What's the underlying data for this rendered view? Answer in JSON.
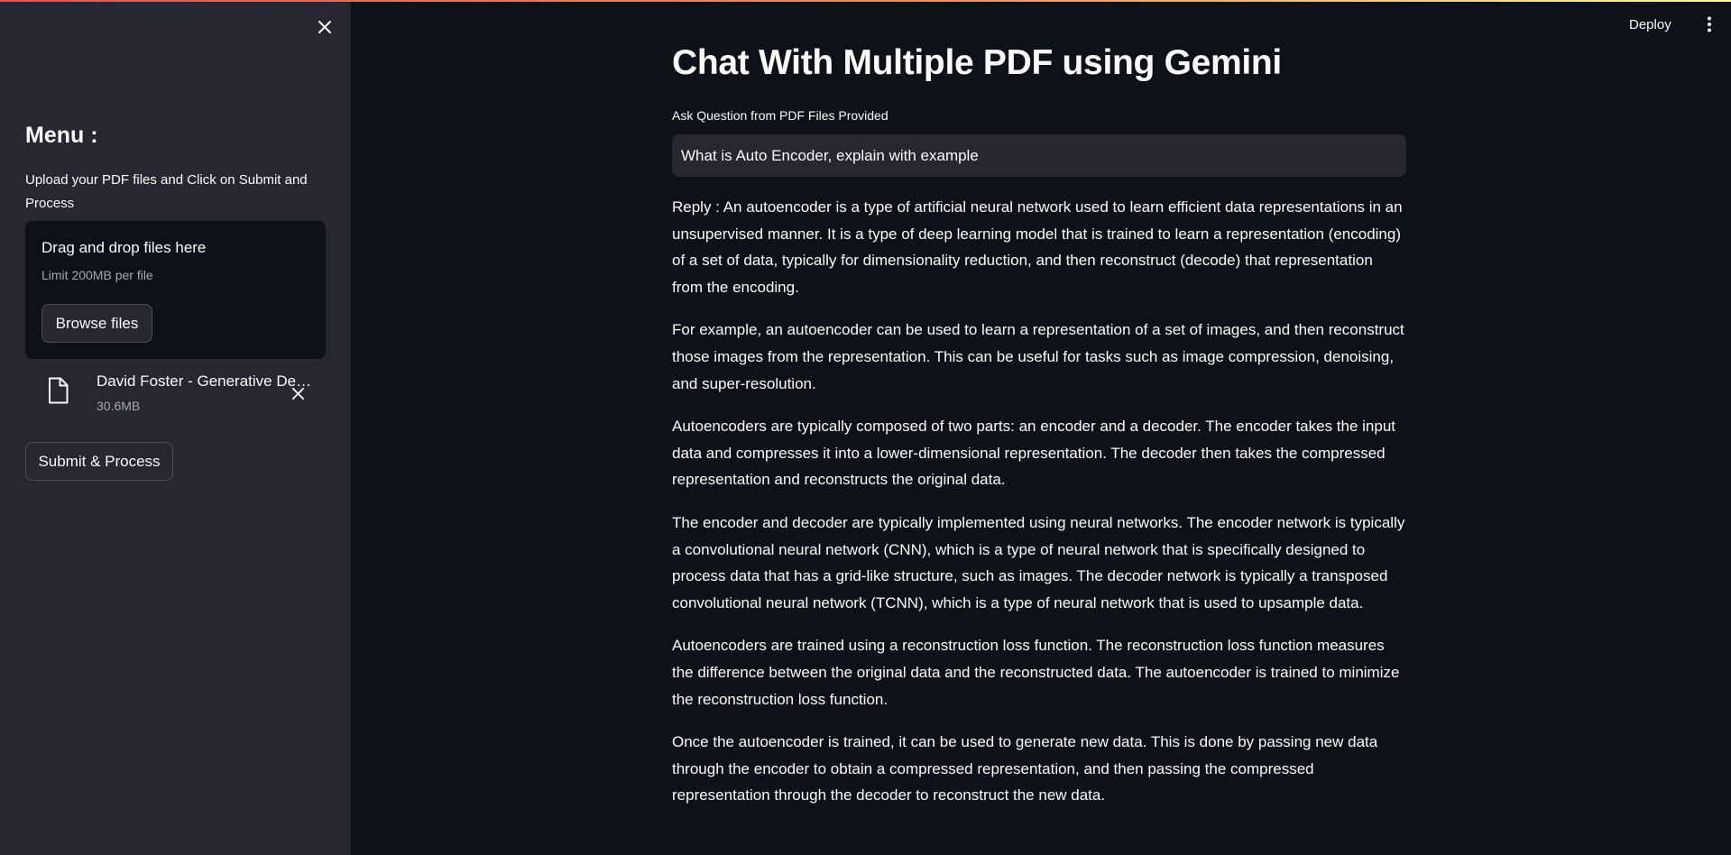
{
  "header": {
    "deploy_label": "Deploy",
    "menu_icon": "kebab-menu-icon"
  },
  "sidebar": {
    "close_icon": "close-icon",
    "title": "Menu :",
    "description": "Upload your PDF files and Click on Submit and Process",
    "uploader": {
      "drop_text": "Drag and drop files here",
      "limit_text": "Limit 200MB per file",
      "browse_label": "Browse files"
    },
    "file": {
      "name": "David Foster - Generative Deep Learning.pdf",
      "size": "30.6MB",
      "icon": "file-icon",
      "remove_icon": "close-icon"
    },
    "submit_label": "Submit & Process"
  },
  "main": {
    "title": "Chat With Multiple PDF using Gemini",
    "question_label": "Ask Question from PDF Files Provided",
    "question_value": "What is Auto Encoder, explain with example",
    "reply_paragraphs": [
      "Reply : An autoencoder is a type of artificial neural network used to learn efficient data representations in an unsupervised manner. It is a type of deep learning model that is trained to learn a representation (encoding) of a set of data, typically for dimensionality reduction, and then reconstruct (decode) that representation from the encoding.",
      "For example, an autoencoder can be used to learn a representation of a set of images, and then reconstruct those images from the representation. This can be useful for tasks such as image compression, denoising, and super-resolution.",
      "Autoencoders are typically composed of two parts: an encoder and a decoder. The encoder takes the input data and compresses it into a lower-dimensional representation. The decoder then takes the compressed representation and reconstructs the original data.",
      "The encoder and decoder are typically implemented using neural networks. The encoder network is typically a convolutional neural network (CNN), which is a type of neural network that is specifically designed to process data that has a grid-like structure, such as images. The decoder network is typically a transposed convolutional neural network (TCNN), which is a type of neural network that is used to upsample data.",
      "Autoencoders are trained using a reconstruction loss function. The reconstruction loss function measures the difference between the original data and the reconstructed data. The autoencoder is trained to minimize the reconstruction loss function.",
      "Once the autoencoder is trained, it can be used to generate new data. This is done by passing new data through the encoder to obtain a compressed representation, and then passing the compressed representation through the decoder to reconstruct the new data."
    ]
  },
  "colors": {
    "background": "#0e1117",
    "sidebar": "#262730",
    "text": "#fafafa",
    "muted": "#a3a8b4",
    "accent_gradient_start": "#ff4b4b",
    "accent_gradient_end": "#fffd80"
  }
}
